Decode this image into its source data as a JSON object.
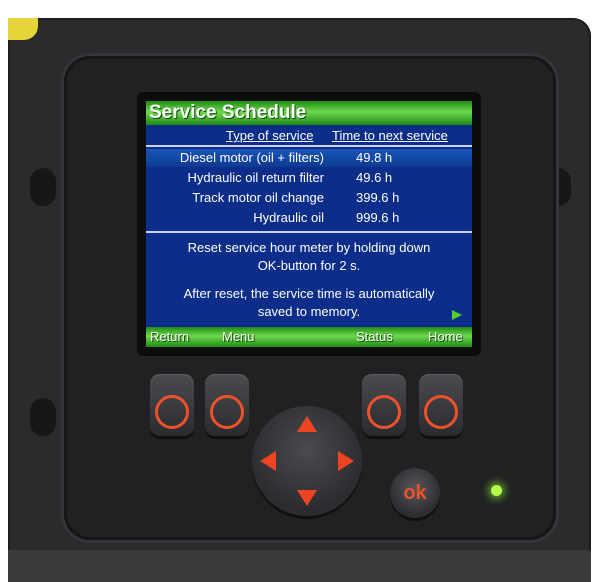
{
  "screen": {
    "title": "Service Schedule",
    "column_headers": [
      "Type of service",
      "Time to next service"
    ],
    "services": [
      {
        "name": "Diesel motor (oil + filters)",
        "time": "49.8 h"
      },
      {
        "name": "Hydraulic oil return filter",
        "time": "49.6 h"
      },
      {
        "name": "Track motor oil change",
        "time": "399.6 h"
      },
      {
        "name": "Hydraulic oil",
        "time": "999.6 h"
      }
    ],
    "selected_row": 0,
    "message_1": [
      "Reset service hour meter by holding down",
      "OK-button for 2 s."
    ],
    "message_2": [
      "After reset, the service time is automatically",
      "saved to memory."
    ],
    "softkeys": [
      "Return",
      "Menu",
      "Status",
      "Home"
    ]
  },
  "controls": {
    "ok_label": "ok",
    "led_color": "#b6ff4a",
    "accent_color": "#f0502a"
  }
}
